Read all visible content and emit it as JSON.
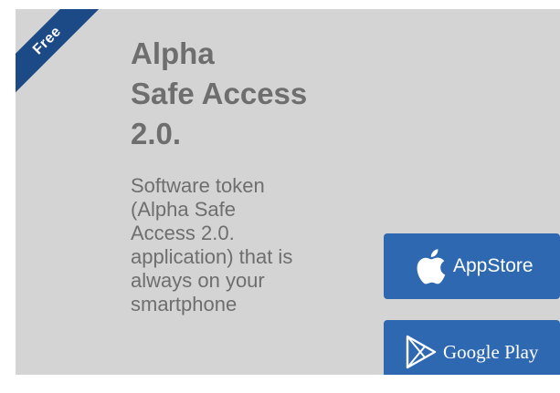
{
  "badge": {
    "label": "Free"
  },
  "app": {
    "title_lines": [
      "Alpha",
      "Safe Access",
      "2.0."
    ],
    "description_lines": [
      "Software token",
      "(Alpha Safe",
      "Access 2.0.",
      "application) that is",
      "always on your",
      "smartphone"
    ]
  },
  "stores": {
    "appstore": {
      "label": "AppStore",
      "icon": "apple-icon"
    },
    "googleplay": {
      "label": "Google Play",
      "icon": "google-play-icon"
    }
  },
  "colors": {
    "card_background": "#d4d4d4",
    "text": "#6e6e6e",
    "badge": "#1b4a86",
    "button": "#2e68b0"
  }
}
